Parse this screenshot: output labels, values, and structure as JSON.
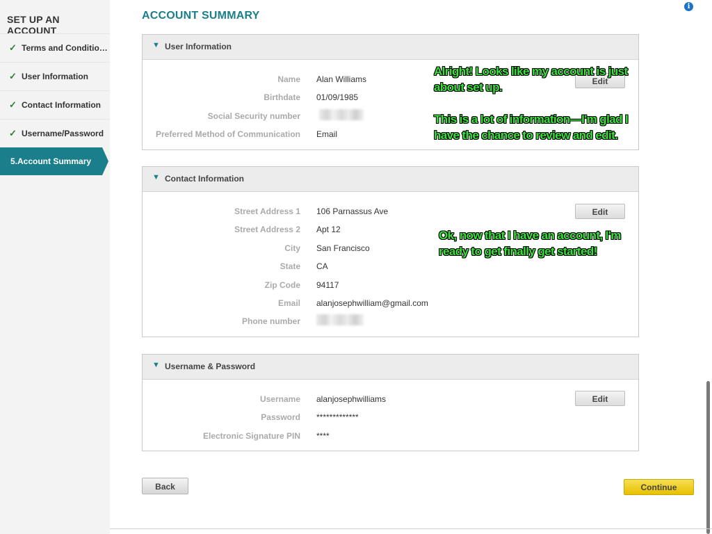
{
  "sidebar": {
    "title": "SET UP AN ACCOUNT",
    "items": [
      {
        "label": "Terms and Conditio…",
        "check": "✓"
      },
      {
        "label": "User Information",
        "check": "✓"
      },
      {
        "label": "Contact Information",
        "check": "✓"
      },
      {
        "label": "Username/Password",
        "check": "✓"
      }
    ],
    "active_item": {
      "label": "5.Account Summary"
    }
  },
  "header": {
    "title": "ACCOUNT SUMMARY",
    "info_icon": "i"
  },
  "sections": {
    "user_info": {
      "title": "User Information",
      "edit_label": "Edit",
      "fields": [
        {
          "label": "Name",
          "value": "Alan Williams"
        },
        {
          "label": "Birthdate",
          "value": "01/09/1985"
        },
        {
          "label": "Social Security number",
          "value": ""
        },
        {
          "label": "Preferred Method of Communication",
          "value": "Email"
        }
      ]
    },
    "contact_info": {
      "title": "Contact Information",
      "edit_label": "Edit",
      "fields": [
        {
          "label": "Street Address 1",
          "value": "106 Parnassus Ave"
        },
        {
          "label": "Street Address 2",
          "value": "Apt 12"
        },
        {
          "label": "City",
          "value": "San Francisco"
        },
        {
          "label": "State",
          "value": "CA"
        },
        {
          "label": "Zip Code",
          "value": "94117"
        },
        {
          "label": "Email",
          "value": "alanjosephwilliam@gmail.com"
        },
        {
          "label": "Phone number",
          "value": ""
        }
      ]
    },
    "credentials": {
      "title": "Username & Password",
      "edit_label": "Edit",
      "fields": [
        {
          "label": "Username",
          "value": "alanjosephwilliams"
        },
        {
          "label": "Password",
          "value": "*************"
        },
        {
          "label": "Electronic Signature PIN",
          "value": "****"
        }
      ]
    }
  },
  "annotations": {
    "note1": "Alright! Looks like my account is just about set up.",
    "note2": "This is a lot of information—I'm glad I have the chance to review and edit.",
    "note3": "Ok, now that I have an account, I'm ready to get finally get started!"
  },
  "footer": {
    "back_label": "Back",
    "continue_label": "Continue"
  },
  "colors": {
    "accent": "#1a7f8b",
    "continue": "#e6c000",
    "annotation": "#39e23a"
  }
}
